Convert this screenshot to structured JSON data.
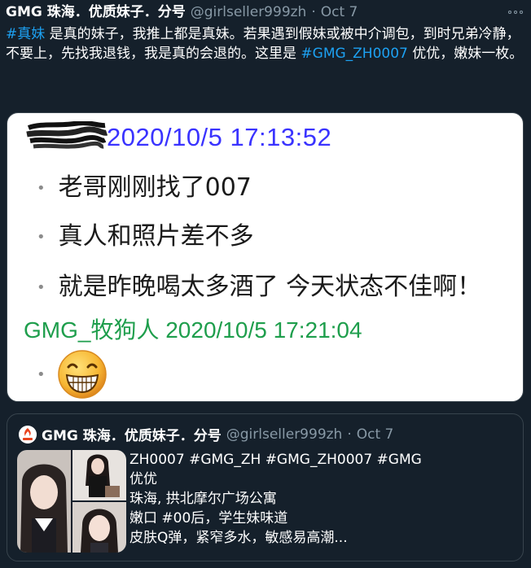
{
  "tweet": {
    "display_name": "GMG 珠海．优质妹子．分号",
    "handle": "@girlseller999zh",
    "separator": "·",
    "date": "Oct 7",
    "text_parts": {
      "hashtag1": "#真妹",
      "text1": " 是真的妹子，我推上都是真妹。若果遇到假妹或被中介调包，到时兄弟冷静，不要上，先找我退钱，我是真的会退的。这里是 ",
      "hashtag2": "#GMG_ZH0007",
      "text2": " 优优，嫩妹一枚。"
    }
  },
  "media": {
    "chat_timestamp": "2020/10/5 17:13:52",
    "lines": [
      "老哥刚刚找了007",
      "真人和照片差不多",
      "就是昨晚喝太多酒了 今天状态不佳啊！"
    ],
    "bullet": "•",
    "reply_user": "GMG_牧狗人 2020/10/5 17:21:04",
    "emoji": "grinning-face"
  },
  "quote": {
    "display_name": "GMG 珠海．优质妹子．分号",
    "handle": "@girlseller999zh",
    "separator": "·",
    "date": "Oct 7",
    "lines": [
      "ZH0007 #GMG_ZH #GMG_ZH0007 #GMG",
      "优优",
      "珠海, 拱北摩尔广场公寓",
      "嫩口 #00后，学生妹味道",
      "皮肤Q弹，紧窄多水，敏感易高潮..."
    ]
  },
  "colors": {
    "background": "#15202b",
    "link": "#1da1f2",
    "secondary_text": "#8899a6",
    "chat_timestamp": "#3a33ff",
    "chat_user": "#1e9e4c"
  }
}
